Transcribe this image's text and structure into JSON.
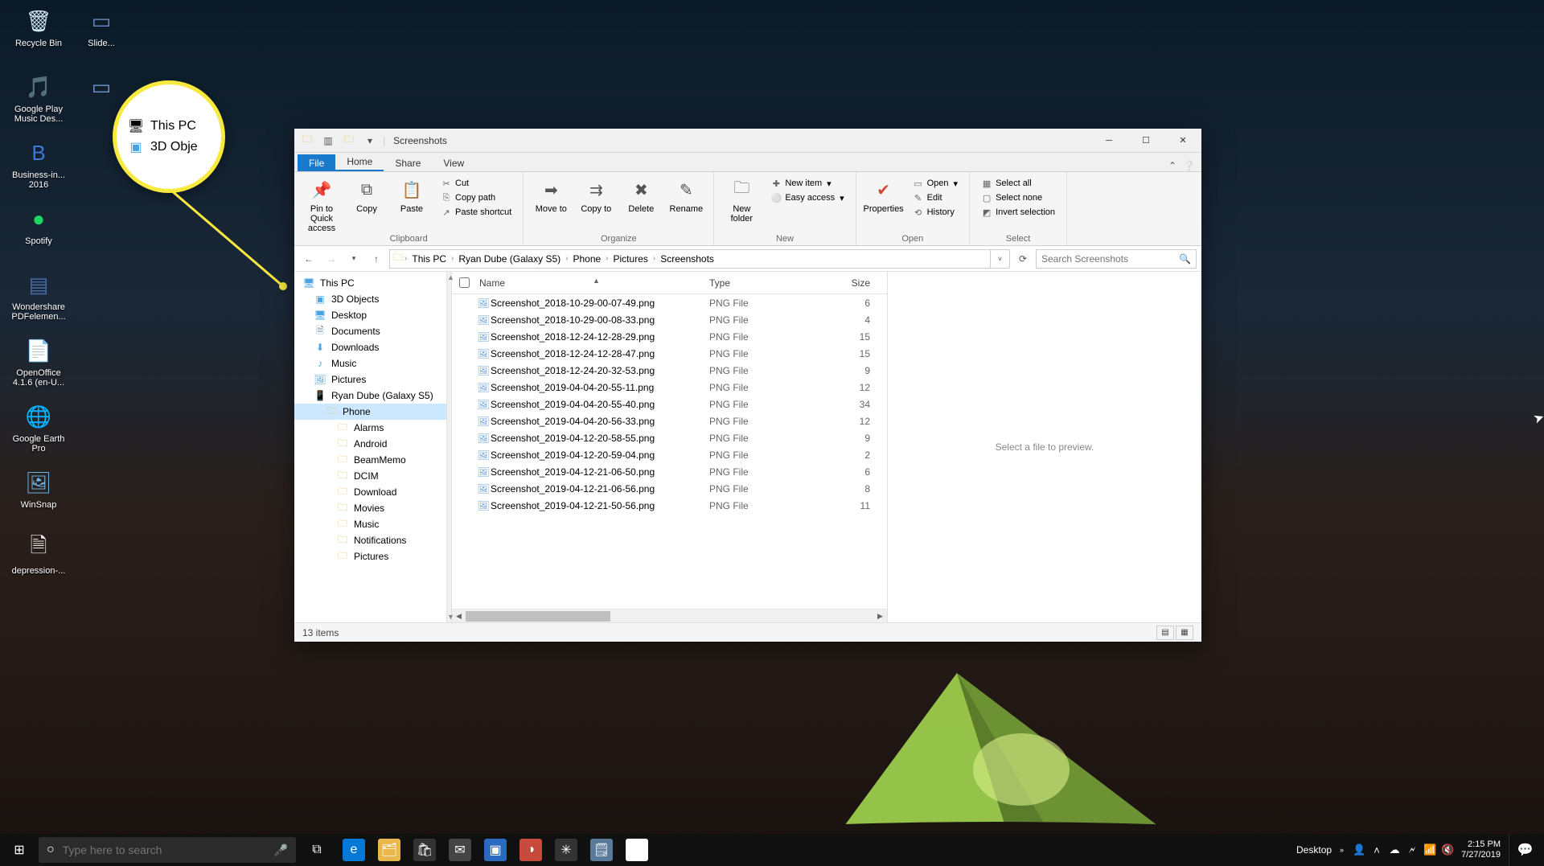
{
  "desktop_icons": [
    {
      "label": "Recycle Bin",
      "glyph": "🗑",
      "color": "#cfe8f7"
    },
    {
      "label": "Google Play Music Des...",
      "glyph": "🎵",
      "color": "#ff9a3c"
    },
    {
      "label": "Business-in... 2016",
      "glyph": "B",
      "color": "#3a7ad6"
    },
    {
      "label": "Spotify",
      "glyph": "●",
      "color": "#1ed760"
    },
    {
      "label": "Wondershare PDFelemen...",
      "glyph": "▤",
      "color": "#4a6aa8"
    },
    {
      "label": "OpenOffice 4.1.6 (en-U...",
      "glyph": "📄",
      "color": "#f0f0f0"
    },
    {
      "label": "Google Earth Pro",
      "glyph": "🌐",
      "color": "#5a7a9a"
    },
    {
      "label": "WinSnap",
      "glyph": "🖼",
      "color": "#6ab0e0"
    },
    {
      "label": "depression-...",
      "glyph": "🗎",
      "color": "#f0f0f0"
    },
    {
      "label": "Slide...",
      "glyph": "▭",
      "color": "#6a8ac0"
    },
    {
      "label": "",
      "glyph": "▭",
      "color": "#6a9ad0"
    }
  ],
  "callout": {
    "line1": "This PC",
    "line2": "3D Obje"
  },
  "explorer": {
    "title": "Screenshots",
    "tabs": {
      "file": "File",
      "home": "Home",
      "share": "Share",
      "view": "View"
    },
    "ribbon": {
      "clipboard": {
        "label": "Clipboard",
        "pin": "Pin to Quick access",
        "copy": "Copy",
        "paste": "Paste",
        "cut": "Cut",
        "copypath": "Copy path",
        "pasteshort": "Paste shortcut"
      },
      "organize": {
        "label": "Organize",
        "moveto": "Move to",
        "copyto": "Copy to",
        "delete": "Delete",
        "rename": "Rename"
      },
      "new": {
        "label": "New",
        "newfolder": "New folder",
        "newitem": "New item",
        "easyaccess": "Easy access"
      },
      "open": {
        "label": "Open",
        "properties": "Properties",
        "open": "Open",
        "edit": "Edit",
        "history": "History"
      },
      "select": {
        "label": "Select",
        "all": "Select all",
        "none": "Select none",
        "invert": "Invert selection"
      }
    },
    "breadcrumb": [
      "This PC",
      "Ryan Dube (Galaxy S5)",
      "Phone",
      "Pictures",
      "Screenshots"
    ],
    "search_placeholder": "Search Screenshots",
    "nav": [
      {
        "label": "This PC",
        "icon": "pc",
        "indent": 0
      },
      {
        "label": "3D Objects",
        "icon": "3d",
        "indent": 1
      },
      {
        "label": "Desktop",
        "icon": "desk",
        "indent": 1
      },
      {
        "label": "Documents",
        "icon": "doc",
        "indent": 1
      },
      {
        "label": "Downloads",
        "icon": "dl",
        "indent": 1
      },
      {
        "label": "Music",
        "icon": "music",
        "indent": 1
      },
      {
        "label": "Pictures",
        "icon": "pic",
        "indent": 1
      },
      {
        "label": "Ryan Dube (Galaxy S5)",
        "icon": "phone",
        "indent": 1
      },
      {
        "label": "Phone",
        "icon": "folder",
        "indent": 2,
        "sel": true
      },
      {
        "label": "Alarms",
        "icon": "folder",
        "indent": 3
      },
      {
        "label": "Android",
        "icon": "folder",
        "indent": 3
      },
      {
        "label": "BeamMemo",
        "icon": "folder",
        "indent": 3
      },
      {
        "label": "DCIM",
        "icon": "folder",
        "indent": 3
      },
      {
        "label": "Download",
        "icon": "folder",
        "indent": 3
      },
      {
        "label": "Movies",
        "icon": "folder",
        "indent": 3
      },
      {
        "label": "Music",
        "icon": "folder",
        "indent": 3
      },
      {
        "label": "Notifications",
        "icon": "folder",
        "indent": 3
      },
      {
        "label": "Pictures",
        "icon": "folder",
        "indent": 3
      }
    ],
    "columns": {
      "name": "Name",
      "type": "Type",
      "size": "Size"
    },
    "files": [
      {
        "name": "Screenshot_2018-10-29-00-07-49.png",
        "type": "PNG File",
        "size": "6"
      },
      {
        "name": "Screenshot_2018-10-29-00-08-33.png",
        "type": "PNG File",
        "size": "4"
      },
      {
        "name": "Screenshot_2018-12-24-12-28-29.png",
        "type": "PNG File",
        "size": "15"
      },
      {
        "name": "Screenshot_2018-12-24-12-28-47.png",
        "type": "PNG File",
        "size": "15"
      },
      {
        "name": "Screenshot_2018-12-24-20-32-53.png",
        "type": "PNG File",
        "size": "9"
      },
      {
        "name": "Screenshot_2019-04-04-20-55-11.png",
        "type": "PNG File",
        "size": "12"
      },
      {
        "name": "Screenshot_2019-04-04-20-55-40.png",
        "type": "PNG File",
        "size": "34"
      },
      {
        "name": "Screenshot_2019-04-04-20-56-33.png",
        "type": "PNG File",
        "size": "12"
      },
      {
        "name": "Screenshot_2019-04-12-20-58-55.png",
        "type": "PNG File",
        "size": "9"
      },
      {
        "name": "Screenshot_2019-04-12-20-59-04.png",
        "type": "PNG File",
        "size": "2"
      },
      {
        "name": "Screenshot_2019-04-12-21-06-50.png",
        "type": "PNG File",
        "size": "6"
      },
      {
        "name": "Screenshot_2019-04-12-21-06-56.png",
        "type": "PNG File",
        "size": "8"
      },
      {
        "name": "Screenshot_2019-04-12-21-50-56.png",
        "type": "PNG File",
        "size": "11"
      }
    ],
    "preview_msg": "Select a file to preview.",
    "status": "13 items"
  },
  "taskbar": {
    "search_placeholder": "Type here to search",
    "apps": [
      {
        "name": "edge",
        "bg": "#0078d7",
        "glyph": "e"
      },
      {
        "name": "explorer",
        "bg": "#e8b84a",
        "glyph": "🗂"
      },
      {
        "name": "store",
        "bg": "#333",
        "glyph": "🛍"
      },
      {
        "name": "mail",
        "bg": "#444",
        "glyph": "✉"
      },
      {
        "name": "app1",
        "bg": "#2a6ac0",
        "glyph": "▣"
      },
      {
        "name": "app2",
        "bg": "#c84a3a",
        "glyph": "◑"
      },
      {
        "name": "app3",
        "bg": "#333",
        "glyph": "✳"
      },
      {
        "name": "app4",
        "bg": "#5a7a9a",
        "glyph": "🗒"
      },
      {
        "name": "chrome",
        "bg": "#fff",
        "glyph": "◎"
      }
    ],
    "tray_label": "Desktop",
    "time": "2:15 PM",
    "date": "7/27/2019"
  }
}
